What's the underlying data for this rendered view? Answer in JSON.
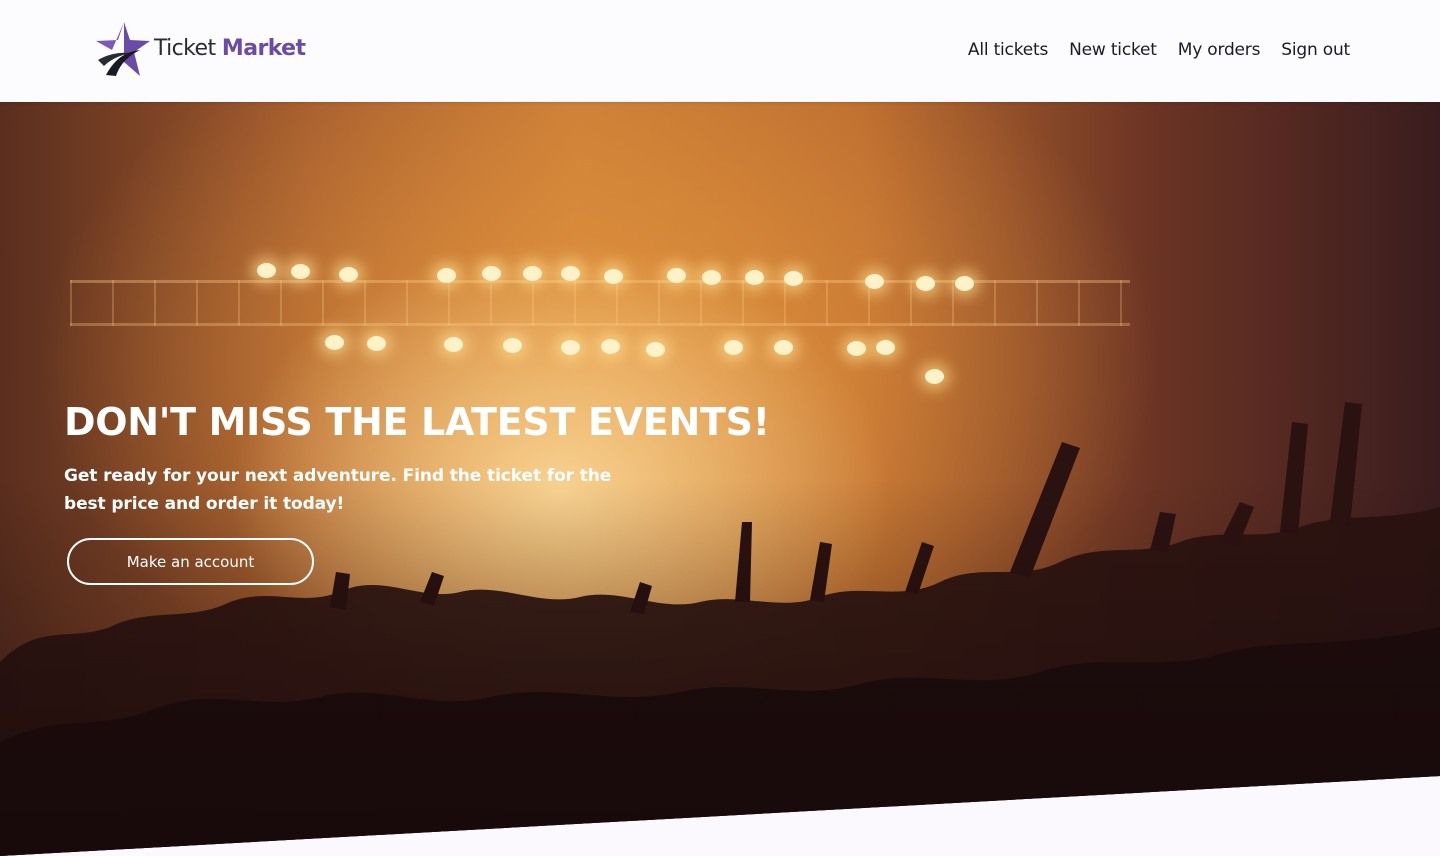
{
  "brand": {
    "name_part1": "Ticket",
    "name_part2": "Market",
    "icon": "star-logo-icon",
    "accent_color": "#6a4ba8"
  },
  "nav": {
    "items": [
      {
        "label": "All tickets"
      },
      {
        "label": "New ticket"
      },
      {
        "label": "My orders"
      },
      {
        "label": "Sign out"
      }
    ]
  },
  "hero": {
    "title": "DON'T MISS THE LATEST EVENTS!",
    "subtitle": "Get ready for your next adventure. Find the ticket for the best price and order it today!",
    "cta_label": "Make an account",
    "background": "concert-crowd-photo"
  }
}
